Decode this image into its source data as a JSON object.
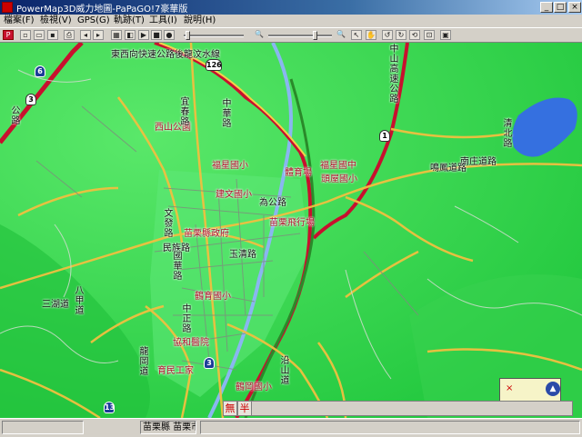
{
  "window": {
    "title": "PowerMap3D威力地圖-PaPaGO!7豪華版",
    "minimize_glyph": "_",
    "maximize_glyph": "□",
    "close_glyph": "×"
  },
  "menu": [
    {
      "label": "檔案(F)"
    },
    {
      "label": "檢視(V)"
    },
    {
      "label": "GPS(G)"
    },
    {
      "label": "軌跡(T)"
    },
    {
      "label": "工具(I)"
    },
    {
      "label": "說明(H)"
    }
  ],
  "toolbar": {
    "icons": [
      "papago-logo-icon",
      "new-file-icon",
      "open-folder-icon",
      "save-icon",
      "print-icon",
      "back-icon",
      "forward-icon",
      "map-2d-icon",
      "map-3d-icon",
      "play-icon",
      "stop-icon",
      "record-icon",
      "zoom-out-icon",
      "zoom-in-icon",
      "pointer-icon",
      "hand-pan-icon",
      "rotate-left-icon",
      "rotate-right-icon",
      "refresh-icon",
      "measure-icon",
      "layer-icon"
    ],
    "zoom_level": 0.75
  },
  "map": {
    "labels": [
      {
        "text": "東西向快速公路後龍汶水線",
        "kind": "road"
      },
      {
        "text": "中山高速公路",
        "kind": "road"
      },
      {
        "text": "西山公園",
        "kind": "poi"
      },
      {
        "text": "宜春路",
        "kind": "road"
      },
      {
        "text": "中華路",
        "kind": "road"
      },
      {
        "text": "福星國小",
        "kind": "poi"
      },
      {
        "text": "體育場",
        "kind": "poi"
      },
      {
        "text": "福星國中",
        "kind": "poi"
      },
      {
        "text": "頭屋國小",
        "kind": "poi"
      },
      {
        "text": "建文國小",
        "kind": "poi"
      },
      {
        "text": "為公路",
        "kind": "road"
      },
      {
        "text": "苗栗飛行場",
        "kind": "poi"
      },
      {
        "text": "文發路",
        "kind": "road"
      },
      {
        "text": "苗栗縣政府",
        "kind": "poi"
      },
      {
        "text": "民族路",
        "kind": "road"
      },
      {
        "text": "國華路",
        "kind": "road"
      },
      {
        "text": "玉清路",
        "kind": "road"
      },
      {
        "text": "鶴育國小",
        "kind": "poi"
      },
      {
        "text": "三湖道",
        "kind": "road"
      },
      {
        "text": "八甲道",
        "kind": "road"
      },
      {
        "text": "中正路",
        "kind": "road"
      },
      {
        "text": "協和醫院",
        "kind": "poi"
      },
      {
        "text": "龍岡道",
        "kind": "road"
      },
      {
        "text": "育民工家",
        "kind": "poi"
      },
      {
        "text": "鶴岡國小",
        "kind": "poi"
      },
      {
        "text": "沿山道",
        "kind": "road"
      },
      {
        "text": "南庄道路",
        "kind": "road"
      },
      {
        "text": "鳴鳳道路",
        "kind": "road"
      },
      {
        "text": "清北路",
        "kind": "road"
      },
      {
        "text": "公路",
        "kind": "road"
      }
    ],
    "shields": [
      {
        "number": "6",
        "style": "blue"
      },
      {
        "number": "3",
        "style": "white"
      },
      {
        "number": "1",
        "style": "white"
      },
      {
        "number": "13",
        "style": "blue"
      },
      {
        "number": "3",
        "style": "blue"
      },
      {
        "number": "126",
        "style": "white"
      }
    ]
  },
  "ime": {
    "mode1": "無",
    "mode2": "半"
  },
  "statusbar": {
    "location": "苗栗縣 苗栗市"
  },
  "compass": {
    "north_glyph": "▲",
    "marker_glyph": "×"
  }
}
